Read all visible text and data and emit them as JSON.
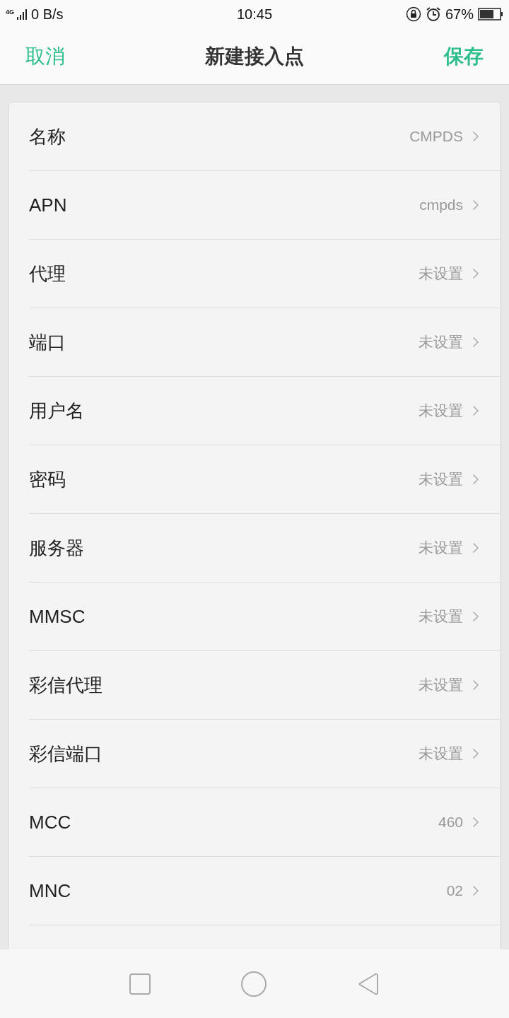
{
  "status_bar": {
    "network": "4G",
    "speed": "0 B/s",
    "time": "10:45",
    "battery": "67%"
  },
  "header": {
    "cancel": "取消",
    "title": "新建接入点",
    "save": "保存"
  },
  "rows": [
    {
      "label": "名称",
      "value": "CMPDS"
    },
    {
      "label": "APN",
      "value": "cmpds"
    },
    {
      "label": "代理",
      "value": "未设置"
    },
    {
      "label": "端口",
      "value": "未设置"
    },
    {
      "label": "用户名",
      "value": "未设置"
    },
    {
      "label": "密码",
      "value": "未设置"
    },
    {
      "label": "服务器",
      "value": "未设置"
    },
    {
      "label": "MMSC",
      "value": "未设置"
    },
    {
      "label": "彩信代理",
      "value": "未设置"
    },
    {
      "label": "彩信端口",
      "value": "未设置"
    },
    {
      "label": "MCC",
      "value": "460"
    },
    {
      "label": "MNC",
      "value": "02"
    }
  ]
}
